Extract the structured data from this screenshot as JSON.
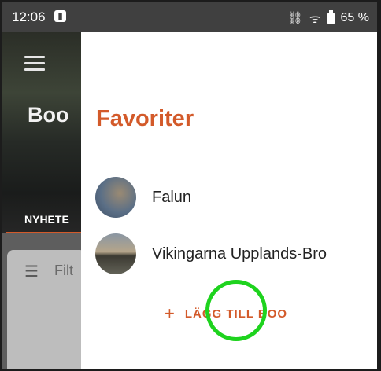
{
  "status_bar": {
    "time": "12:06",
    "icons": "⛓ ᯤ ▮",
    "battery_text": "65 %"
  },
  "background_app": {
    "title": "Boo",
    "tab_label": "NYHETE",
    "filter_label": "Filt",
    "accent_color": "#d35a2a"
  },
  "drawer": {
    "title": "Favoriter",
    "items": [
      {
        "label": "Falun",
        "avatar": "ibex-photo"
      },
      {
        "label": "Vikingarna Upplands-Bro",
        "avatar": "lake-sunset-photo"
      }
    ],
    "add_label": "LÄGG TILL BOO",
    "add_icon": "+"
  },
  "highlight_color": "#1ed31e"
}
